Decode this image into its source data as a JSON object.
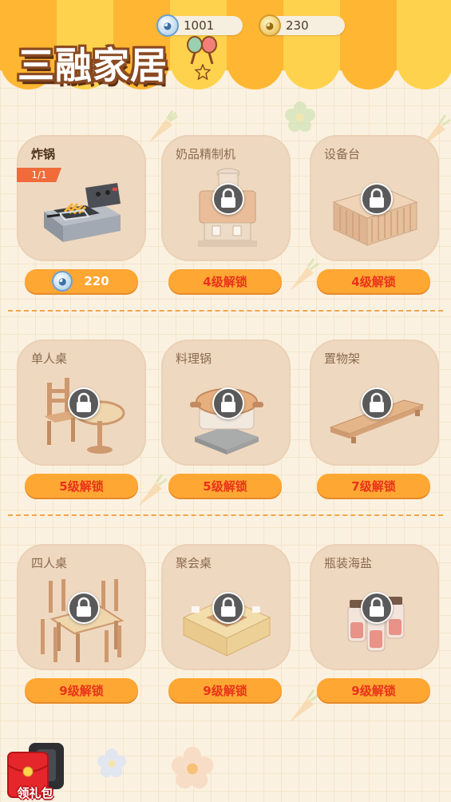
{
  "header": {
    "game_title": "三融家居",
    "currencies": [
      {
        "icon": "silver-coin-icon",
        "value": "1001"
      },
      {
        "icon": "gold-coin-icon",
        "value": "230"
      }
    ]
  },
  "items": [
    {
      "name": "炸锅",
      "unlocked": true,
      "count": "1/1",
      "price": "220",
      "icon": "fryer-icon"
    },
    {
      "name": "奶品精制机",
      "unlocked": false,
      "unlock_text": "4级解锁",
      "icon": "espresso-machine-icon"
    },
    {
      "name": "设备台",
      "unlocked": false,
      "unlock_text": "4级解锁",
      "icon": "equipment-counter-icon"
    },
    {
      "name": "单人桌",
      "unlocked": false,
      "unlock_text": "5级解锁",
      "icon": "single-table-icon"
    },
    {
      "name": "料理锅",
      "unlocked": false,
      "unlock_text": "5级解锁",
      "icon": "cooking-pot-icon"
    },
    {
      "name": "置物架",
      "unlocked": false,
      "unlock_text": "7级解锁",
      "icon": "shelf-icon"
    },
    {
      "name": "四人桌",
      "unlocked": false,
      "unlock_text": "9级解锁",
      "icon": "four-person-table-icon"
    },
    {
      "name": "聚会桌",
      "unlocked": false,
      "unlock_text": "9级解锁",
      "icon": "party-table-icon"
    },
    {
      "name": "瓶装海盐",
      "unlocked": false,
      "unlock_text": "9级解锁",
      "icon": "bottled-sea-salt-icon"
    }
  ],
  "gift_button": {
    "label": "领礼包"
  },
  "colors": {
    "accent_orange": "#ffa733",
    "lock_text": "#e8331a",
    "card": "#efd8c0",
    "background": "#fbf1e0"
  }
}
